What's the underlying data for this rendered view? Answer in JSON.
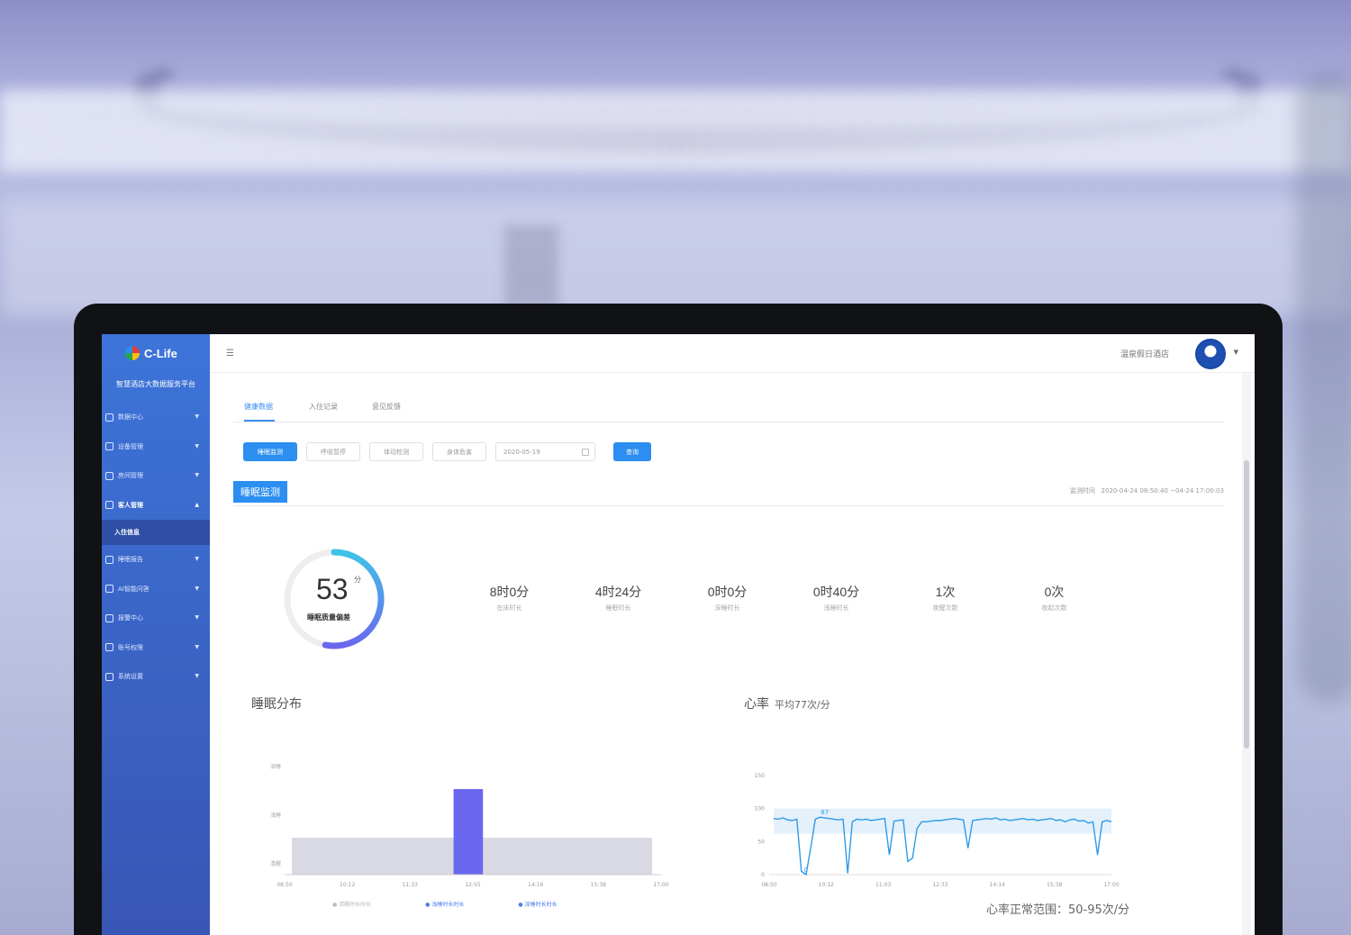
{
  "sidebar": {
    "logo_text": "C-Life",
    "platform_title": "智慧酒店大数据服务平台",
    "items": [
      {
        "label": "数据中心",
        "icon": "dashboard-icon"
      },
      {
        "label": "设备管理",
        "icon": "device-icon"
      },
      {
        "label": "房间管理",
        "icon": "room-icon"
      },
      {
        "label": "客人管理",
        "icon": "guest-icon",
        "open": true
      },
      {
        "label": "睡眠报告",
        "icon": "report-icon"
      },
      {
        "label": "AI智能问答",
        "icon": "ai-icon"
      },
      {
        "label": "报警中心",
        "icon": "alarm-icon"
      },
      {
        "label": "账号权限",
        "icon": "account-icon"
      },
      {
        "label": "系统设置",
        "icon": "settings-icon"
      }
    ],
    "submenu": "入住信息"
  },
  "topbar": {
    "menu_icon": "☰",
    "user_name": "温泉假日酒店"
  },
  "tabs": [
    "健康数据",
    "入住记录",
    "意见反馈"
  ],
  "filters": {
    "buttons": [
      "睡眠监测",
      "呼吸暂停",
      "体动检测",
      "身体危害"
    ],
    "date": "2020-05-19",
    "query": "查询"
  },
  "section": {
    "title": "睡眠监测",
    "monitor_label": "监测时间",
    "monitor_range": "2020-04-24 08:50:40 ~04-24 17:00:03"
  },
  "score": {
    "value": "53",
    "unit": "分",
    "label": "睡眠质量偏差",
    "fraction": 0.53
  },
  "stats": [
    {
      "value": "8时0分",
      "label": "在床时长"
    },
    {
      "value": "4时24分",
      "label": "睡眠时长"
    },
    {
      "value": "0时0分",
      "label": "深睡时长"
    },
    {
      "value": "0时40分",
      "label": "浅睡时长"
    },
    {
      "value": "1次",
      "label": "夜醒次数"
    },
    {
      "value": "0次",
      "label": "夜起次数"
    }
  ],
  "colors": {
    "primary": "#2b8ef0",
    "sidebar": "#3a63c4",
    "sleep_bar": "#6a67ef",
    "awake_area": "#d9d9e3",
    "hr_line": "#2e9be8",
    "hr_band": "#e4f1fb"
  },
  "chart_data": [
    {
      "type": "bar",
      "title": "睡眠分布",
      "categories": [
        "08:50",
        "10:12",
        "11:33",
        "12:55",
        "14:16",
        "15:38",
        "17:00"
      ],
      "y_levels": [
        "深睡",
        "浅睡",
        "清醒"
      ],
      "legend": [
        "清醒时长时长",
        "浅睡时长时长",
        "深睡时长时长"
      ],
      "segments": [
        {
          "state": "清醒",
          "start": "08:50",
          "end": "17:00"
        },
        {
          "state": "深睡",
          "start": "12:30",
          "end": "13:10"
        }
      ]
    },
    {
      "type": "line",
      "title": "心率",
      "subtitle": "平均77次/分",
      "x_ticks": [
        "08:50",
        "10:12",
        "11:03",
        "12:33",
        "14:14",
        "15:38",
        "17:00"
      ],
      "y_ticks": [
        0,
        50,
        100,
        150
      ],
      "ylim": [
        0,
        150
      ],
      "band": [
        62,
        100
      ],
      "annotations": [
        {
          "label": "87",
          "x": 0.15,
          "y": 87
        },
        {
          "label": "0",
          "x": 0.1,
          "y": 0
        }
      ],
      "values": [
        85,
        84,
        86,
        83,
        82,
        84,
        5,
        0,
        40,
        84,
        87,
        86,
        85,
        84,
        83,
        84,
        2,
        80,
        84,
        83,
        84,
        82,
        83,
        84,
        85,
        30,
        81,
        82,
        83,
        20,
        25,
        70,
        80,
        80,
        81,
        82,
        82,
        83,
        84,
        85,
        84,
        83,
        40,
        82,
        83,
        84,
        85,
        84,
        86,
        83,
        84,
        82,
        83,
        84,
        85,
        83,
        84,
        82,
        83,
        84,
        85,
        82,
        83,
        80,
        83,
        84,
        81,
        82,
        78,
        80,
        30,
        80,
        82,
        80
      ],
      "range_text": "心率正常范围：50-95次/分"
    }
  ]
}
